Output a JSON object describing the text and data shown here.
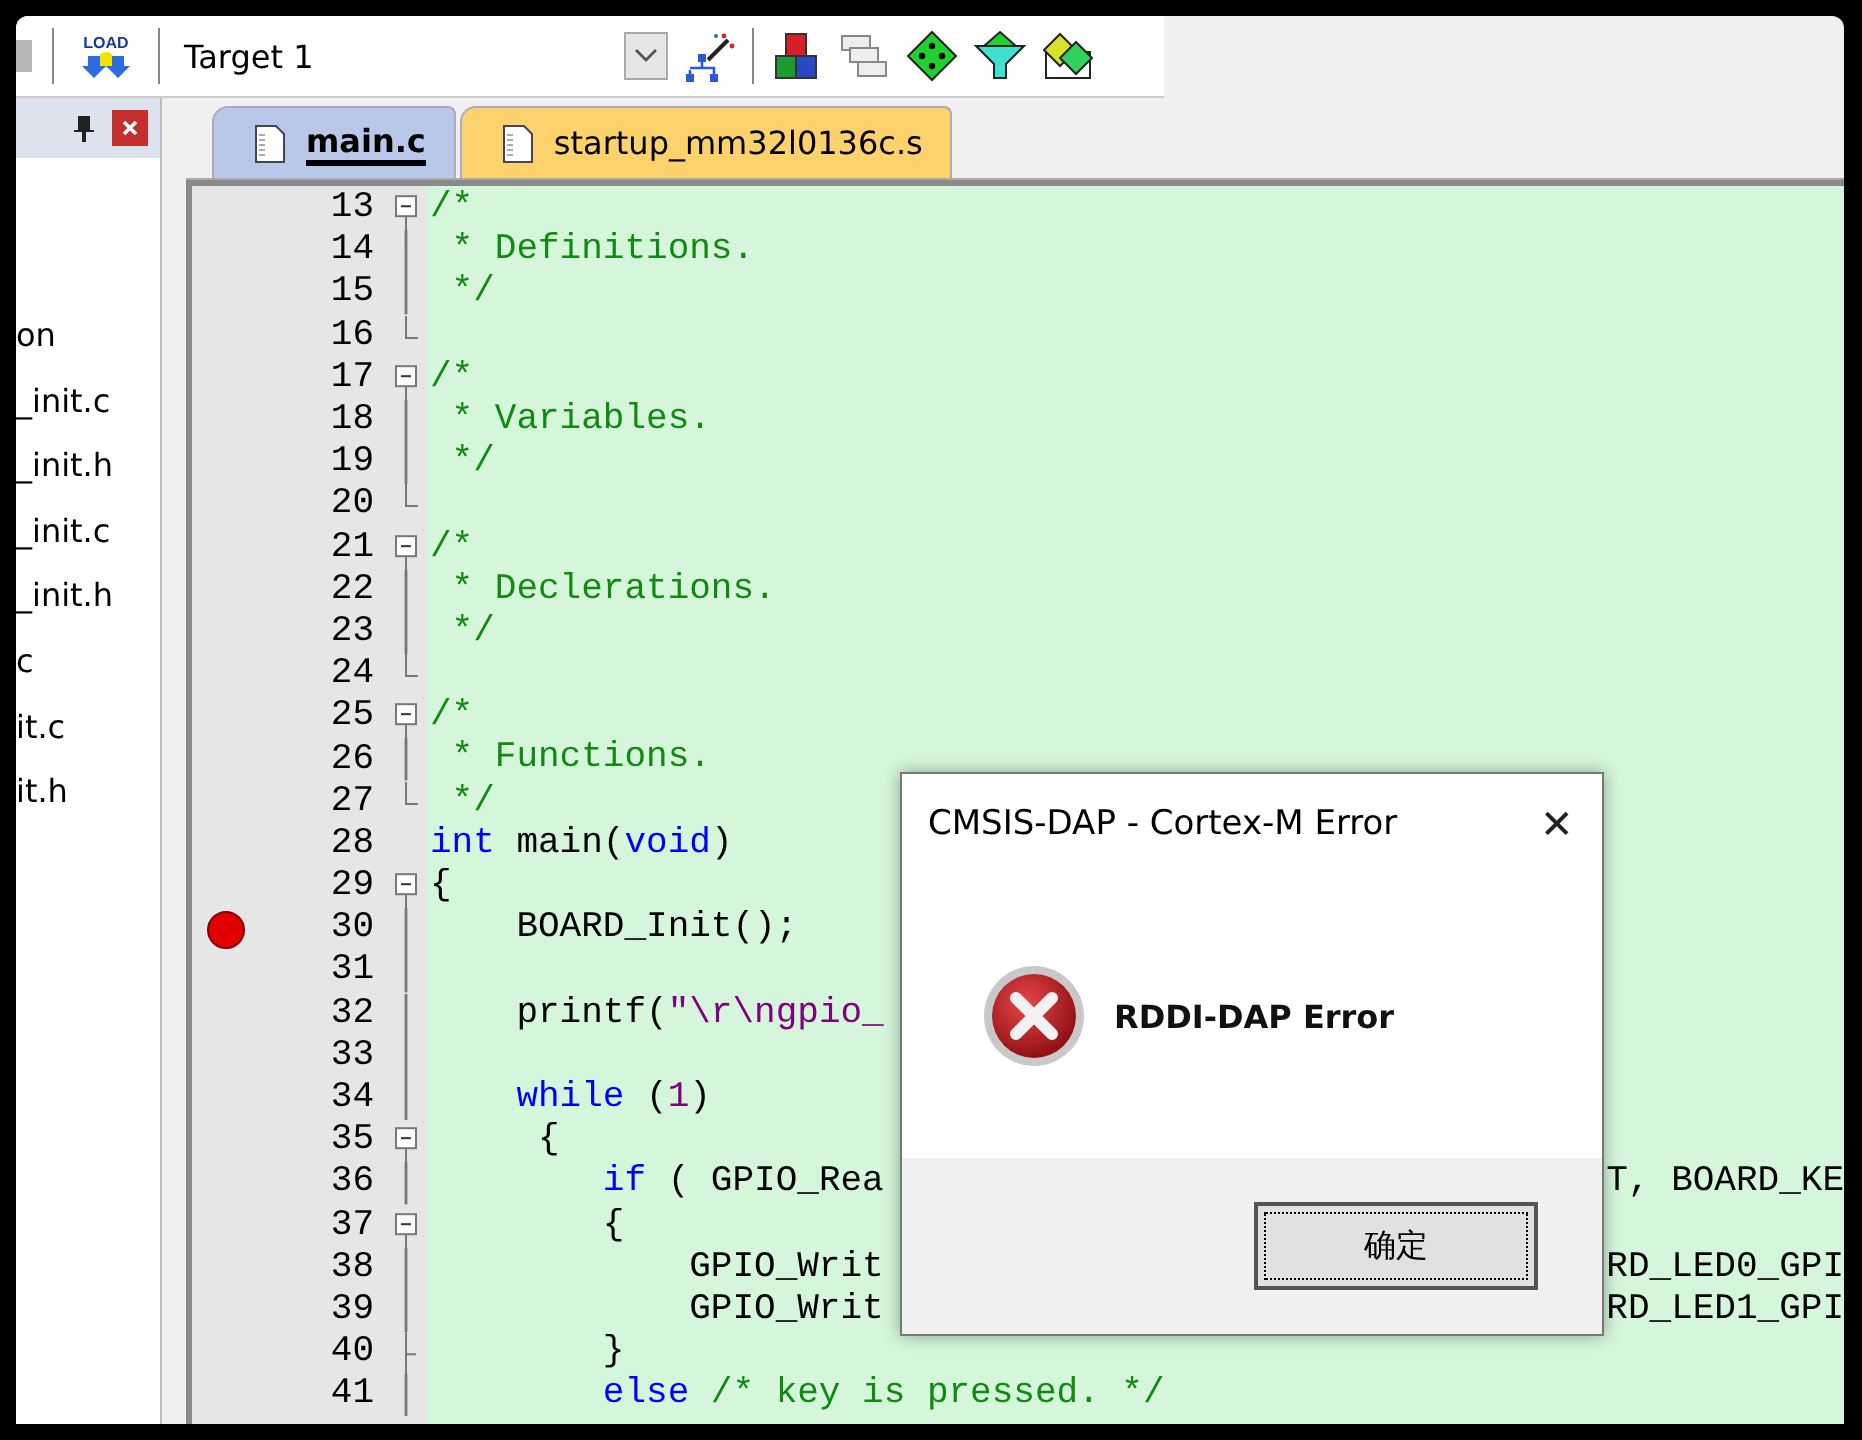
{
  "toolbar": {
    "load_label": "LOAD",
    "target": "Target 1"
  },
  "project_panel": {
    "items": [
      {
        "label": "on"
      },
      {
        "label": "_init.c"
      },
      {
        "label": "_init.h"
      },
      {
        "label": "_init.c"
      },
      {
        "label": "_init.h"
      },
      {
        "label": "c"
      },
      {
        "label": "it.c"
      },
      {
        "label": "it.h"
      }
    ]
  },
  "tabs": [
    {
      "label": "main.c",
      "selected": true
    },
    {
      "label": "startup_mm32l0136c.s",
      "selected": false
    }
  ],
  "editor": {
    "lines": [
      {
        "number": "13",
        "kind": "open",
        "breakpoint": false,
        "segments": [
          {
            "kind": "comment",
            "text": "/*"
          }
        ]
      },
      {
        "number": "14",
        "kind": "line",
        "breakpoint": false,
        "segments": [
          {
            "kind": "comment",
            "text": " * Definitions."
          }
        ]
      },
      {
        "number": "15",
        "kind": "line",
        "breakpoint": false,
        "segments": [
          {
            "kind": "comment",
            "text": " */"
          }
        ]
      },
      {
        "number": "16",
        "kind": "end",
        "breakpoint": false
      },
      {
        "number": "17",
        "kind": "open",
        "breakpoint": false,
        "segments": [
          {
            "kind": "comment",
            "text": "/*"
          }
        ]
      },
      {
        "number": "18",
        "kind": "line",
        "breakpoint": false,
        "segments": [
          {
            "kind": "comment",
            "text": " * Variables."
          }
        ]
      },
      {
        "number": "19",
        "kind": "line",
        "breakpoint": false,
        "segments": [
          {
            "kind": "comment",
            "text": " */"
          }
        ]
      },
      {
        "number": "20",
        "kind": "end",
        "breakpoint": false
      },
      {
        "number": "21",
        "kind": "open",
        "breakpoint": false,
        "segments": [
          {
            "kind": "comment",
            "text": "/*"
          }
        ]
      },
      {
        "number": "22",
        "kind": "line",
        "breakpoint": false,
        "segments": [
          {
            "kind": "comment",
            "text": " * Declerations."
          }
        ]
      },
      {
        "number": "23",
        "kind": "line",
        "breakpoint": false,
        "segments": [
          {
            "kind": "comment",
            "text": " */"
          }
        ]
      },
      {
        "number": "24",
        "kind": "end",
        "breakpoint": false
      },
      {
        "number": "25",
        "kind": "open",
        "breakpoint": false,
        "segments": [
          {
            "kind": "comment",
            "text": "/*"
          }
        ]
      },
      {
        "number": "26",
        "kind": "line",
        "breakpoint": false,
        "segments": [
          {
            "kind": "comment",
            "text": " * Functions."
          }
        ]
      },
      {
        "number": "27",
        "kind": "end",
        "breakpoint": false,
        "segments": [
          {
            "kind": "comment",
            "text": " */"
          }
        ]
      },
      {
        "number": "28",
        "kind": "plain",
        "breakpoint": false,
        "segments": [
          {
            "kind": "keyword",
            "text": "int"
          },
          {
            "kind": "plain",
            "text": " main("
          },
          {
            "kind": "keyword",
            "text": "void"
          },
          {
            "kind": "plain",
            "text": ")"
          }
        ]
      },
      {
        "number": "29",
        "kind": "open",
        "breakpoint": false,
        "segments": [
          {
            "kind": "plain",
            "text": "{"
          }
        ]
      },
      {
        "number": "30",
        "kind": "line",
        "breakpoint": true,
        "segments": [
          {
            "kind": "plain",
            "text": "    BOARD_Init();"
          }
        ]
      },
      {
        "number": "31",
        "kind": "line",
        "breakpoint": false
      },
      {
        "number": "32",
        "kind": "line",
        "breakpoint": false,
        "segments": [
          {
            "kind": "plain",
            "text": "    printf("
          },
          {
            "kind": "string",
            "text": "\"\\r\\ngpio_"
          }
        ]
      },
      {
        "number": "33",
        "kind": "line",
        "breakpoint": false
      },
      {
        "number": "34",
        "kind": "line",
        "breakpoint": false,
        "segments": [
          {
            "kind": "keyword",
            "text": "    while"
          },
          {
            "kind": "plain",
            "text": " ("
          },
          {
            "kind": "number",
            "text": "1"
          },
          {
            "kind": "plain",
            "text": ")"
          }
        ]
      },
      {
        "number": "35",
        "kind": "open",
        "breakpoint": false,
        "segments": [
          {
            "kind": "plain",
            "text": "     {"
          }
        ]
      },
      {
        "number": "36",
        "kind": "line",
        "breakpoint": false,
        "segments": [
          {
            "kind": "keyword",
            "text": "        if"
          },
          {
            "kind": "plain",
            "text": " ( GPIO_Rea"
          }
        ],
        "tail": "T, BOARD_KE"
      },
      {
        "number": "37",
        "kind": "open",
        "breakpoint": false,
        "segments": [
          {
            "kind": "plain",
            "text": "        {"
          }
        ]
      },
      {
        "number": "38",
        "kind": "line",
        "breakpoint": false,
        "segments": [
          {
            "kind": "plain",
            "text": "            GPIO_Writ"
          }
        ],
        "tail": "RD_LED0_GPI"
      },
      {
        "number": "39",
        "kind": "line",
        "breakpoint": false,
        "segments": [
          {
            "kind": "plain",
            "text": "            GPIO_Writ"
          }
        ],
        "tail": "RD_LED1_GPI"
      },
      {
        "number": "40",
        "kind": "branch",
        "breakpoint": false,
        "segments": [
          {
            "kind": "plain",
            "text": "        }"
          }
        ]
      },
      {
        "number": "41",
        "kind": "line",
        "breakpoint": false,
        "segments": [
          {
            "kind": "keyword",
            "text": "        else"
          },
          {
            "kind": "comment",
            "text": " /* key is pressed. */"
          }
        ]
      }
    ]
  },
  "dialog": {
    "title": "CMSIS-DAP - Cortex-M Error",
    "close": "✕",
    "message": "RDDI-DAP Error",
    "button": "确定"
  }
}
